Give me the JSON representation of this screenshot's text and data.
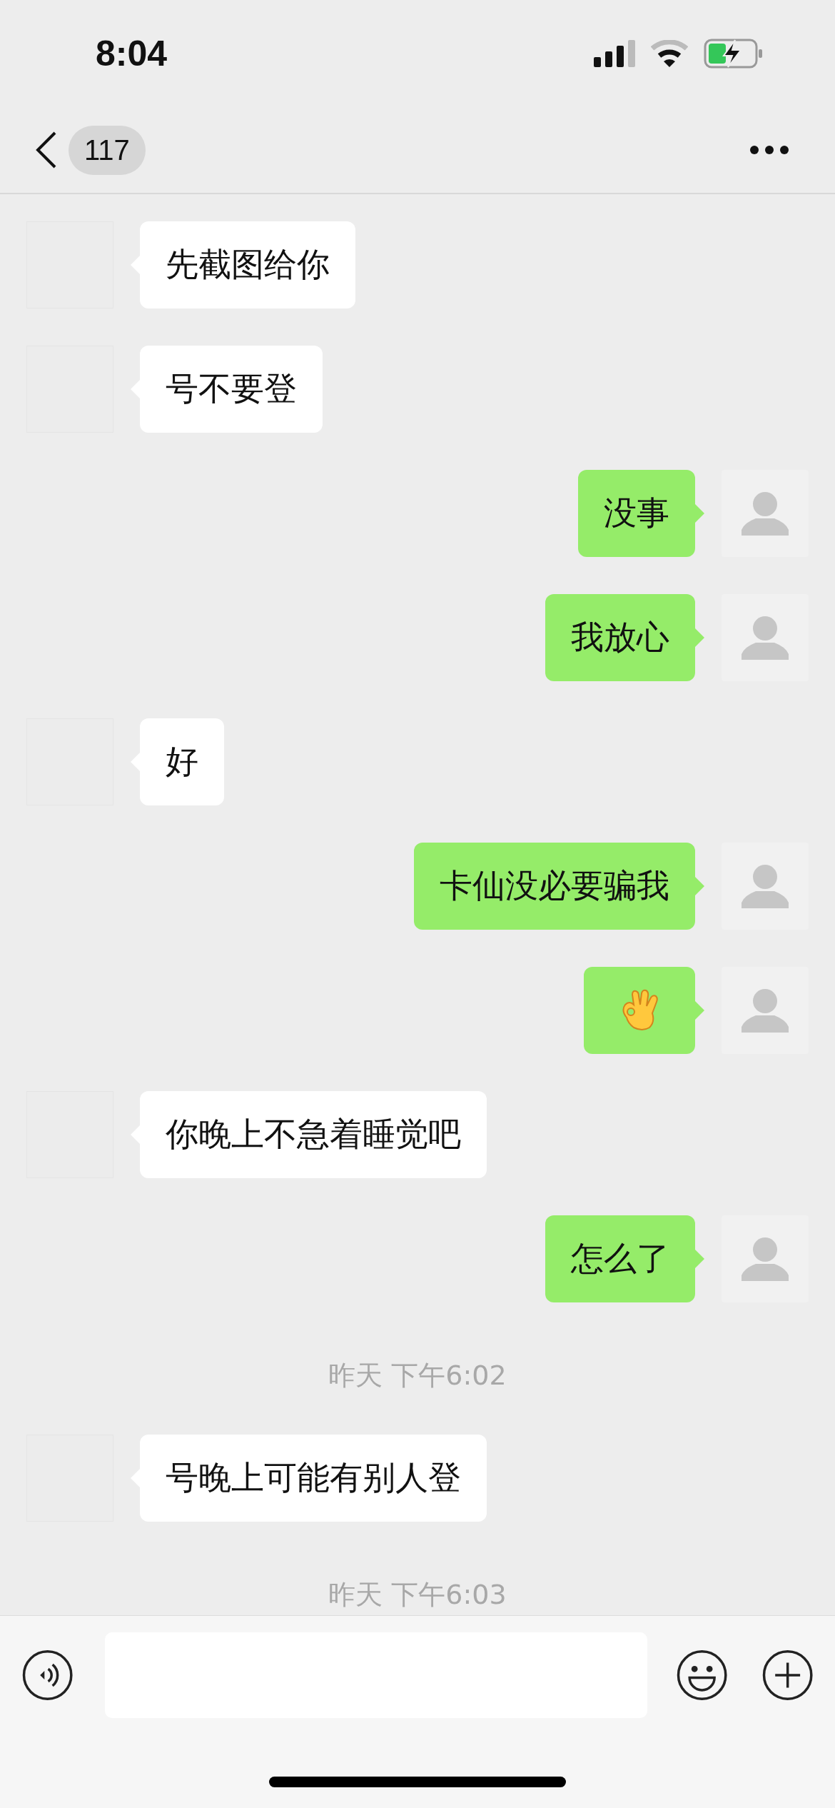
{
  "status_bar": {
    "time": "8:04"
  },
  "header": {
    "unread_count": "117"
  },
  "messages": [
    {
      "kind": "text",
      "outgoing": false,
      "text": "先截图给你"
    },
    {
      "kind": "text",
      "outgoing": false,
      "text": "号不要登"
    },
    {
      "kind": "text",
      "outgoing": true,
      "text": "没事"
    },
    {
      "kind": "text",
      "outgoing": true,
      "text": "我放心"
    },
    {
      "kind": "text",
      "outgoing": false,
      "text": "好"
    },
    {
      "kind": "text",
      "outgoing": true,
      "text": "卡仙没必要骗我"
    },
    {
      "kind": "emoji",
      "outgoing": true
    },
    {
      "kind": "text",
      "outgoing": false,
      "text": "你晚上不急着睡觉吧"
    },
    {
      "kind": "text",
      "outgoing": true,
      "text": "怎么了"
    },
    {
      "kind": "time",
      "text": "昨天 下午6:02"
    },
    {
      "kind": "text",
      "outgoing": false,
      "text": "号晚上可能有别人登"
    },
    {
      "kind": "time",
      "text": "昨天 下午6:03"
    }
  ]
}
